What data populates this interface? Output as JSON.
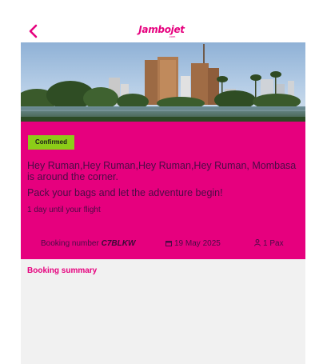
{
  "header": {
    "logo_text": "Jambojet",
    "logo_subtext": ".com"
  },
  "booking": {
    "status": "Confirmed",
    "greeting": "Hey Ruman,Hey Ruman,Hey Ruman,Hey Ruman, Mombasa is around the corner.",
    "tagline": "Pack your bags and let the adventure begin!",
    "countdown": "1 day until your flight",
    "number_label": "Booking number",
    "number_value": "C7BLKW",
    "date": "19 May 2025",
    "pax": "1 Pax"
  },
  "summary": {
    "title": "Booking summary"
  },
  "colors": {
    "brand": "#e6007e",
    "status_confirmed": "#8ccd18",
    "text_dark": "#4a0b45",
    "summary_bg": "#f1f1f1"
  },
  "icons": {
    "back": "chevron-left-icon",
    "date": "calendar-icon",
    "pax": "person-icon"
  }
}
